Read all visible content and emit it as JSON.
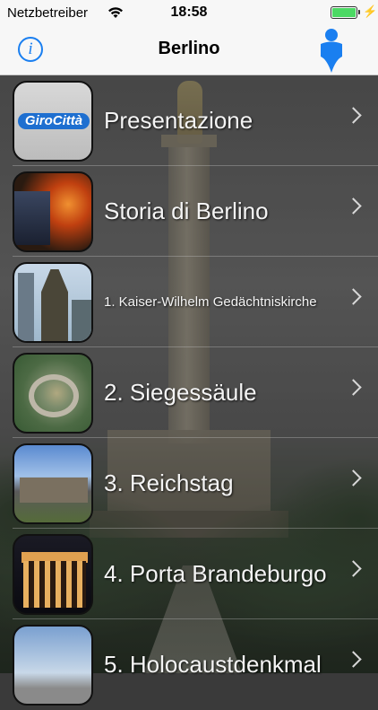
{
  "status_bar": {
    "carrier": "Netzbetreiber",
    "time": "18:58",
    "battery_level": 1.0,
    "charging_icon": "bolt-icon"
  },
  "nav": {
    "title": "Berlino",
    "info_icon": "info-icon",
    "location_icon": "location-pin-icon"
  },
  "colors": {
    "accent": "#1a7ff0",
    "battery": "#4cd964",
    "navbar": "#f7f7f7"
  },
  "menu": {
    "items": [
      {
        "label": "Presentazione",
        "thumb_text": "GiroCittà"
      },
      {
        "label": "Storia di Berlino"
      },
      {
        "label": "1. Kaiser-Wilhelm Gedächtniskirche"
      },
      {
        "label": "2. Siegessäule"
      },
      {
        "label": "3. Reichstag"
      },
      {
        "label": "4. Porta Brandeburgo"
      },
      {
        "label": "5. Holocaustdenkmal"
      }
    ]
  }
}
